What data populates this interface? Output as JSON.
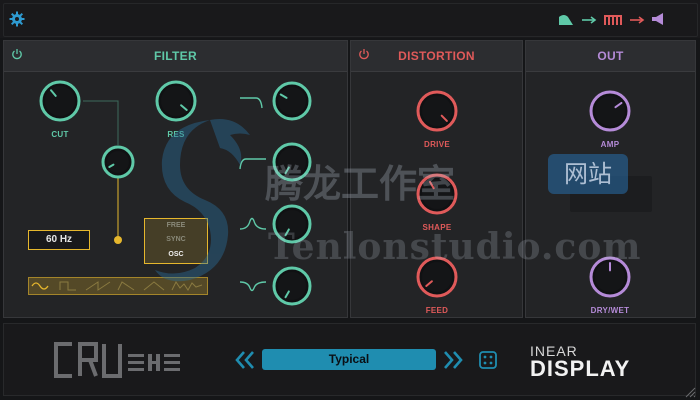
{
  "colors": {
    "filter_accent": "#5fc9a8",
    "distortion_accent": "#e05a5a",
    "out_accent": "#b58bd8",
    "preset_bar": "#1f8db0",
    "mode_highlight": "#e6b72d",
    "top_gear": "#2e9bd1"
  },
  "top": {
    "settings_icon": "gear-icon",
    "signal_chain": [
      "filter-shape-icon",
      "arrow-right-icon",
      "distortion-bars-icon",
      "arrow-right-icon",
      "speaker-icon"
    ]
  },
  "filter": {
    "title": "FILTER",
    "power_icon": "power-icon",
    "knobs": {
      "cut": "CUT",
      "res": "RES"
    },
    "cutoff_value": "60 Hz",
    "mode_options": [
      "FREE",
      "SYNC",
      "OSC"
    ],
    "mode_selected": "OSC",
    "types": [
      "lowpass-icon",
      "highpass-icon",
      "bandpass-icon",
      "notch-icon"
    ]
  },
  "distortion": {
    "title": "DISTORTION",
    "power_icon": "power-icon",
    "knobs": {
      "drive": "DRIVE",
      "shape": "SHAPE",
      "feed": "FEED"
    }
  },
  "out": {
    "title": "OUT",
    "knobs": {
      "amp": "AMP",
      "drywet": "DRY/WET"
    }
  },
  "bottom": {
    "product_logo": "CRUSHE",
    "prev_icon": "double-chevron-left-icon",
    "preset_name": "Typical",
    "next_icon": "double-chevron-right-icon",
    "random_icon": "dice-icon",
    "brand_top": "INEAR",
    "brand_bottom": "DISPLAY"
  },
  "watermark": {
    "chinese": "腾龙工作室",
    "badge": "网站",
    "url": "Tenlonstudio.com"
  }
}
